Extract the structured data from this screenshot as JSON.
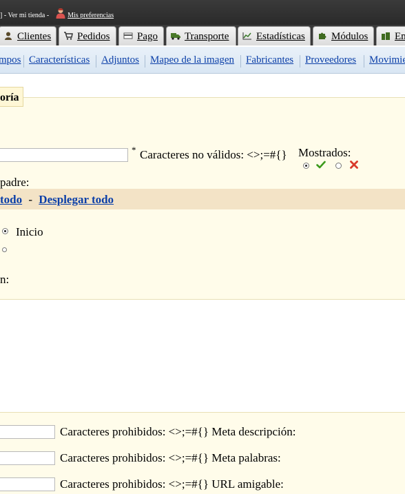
{
  "header": {
    "prefix_text": "] - Ver mi tienda -",
    "preferences_link": "Mis preferencias"
  },
  "tabs": [
    {
      "label": "Clientes",
      "icon": "person-icon"
    },
    {
      "label": "Pedidos",
      "icon": "cart-icon"
    },
    {
      "label": "Pago",
      "icon": "card-icon"
    },
    {
      "label": "Transporte",
      "icon": "truck-icon"
    },
    {
      "label": "Estadísticas",
      "icon": "chart-icon"
    },
    {
      "label": "Módulos",
      "icon": "puzzle-icon"
    },
    {
      "label": "Em",
      "icon": "building-icon"
    }
  ],
  "subnav": {
    "items": [
      "mpos",
      "Características",
      "Adjuntos",
      "Mapeo de la imagen",
      "Fabricantes",
      "Proveedores",
      "Movimie"
    ]
  },
  "form": {
    "legend": "oría",
    "name_value": "",
    "required_mark": "*",
    "invalid_chars": "Caracteres no válidos: <>;=#{}",
    "shown_label": "Mostrados:",
    "parent_label": "padre:",
    "tree_collapse": "todo",
    "tree_separator": "-",
    "tree_expand": "Desplegar todo",
    "root_label": "Inicio",
    "description_label": "n:"
  },
  "meta": {
    "rows": [
      {
        "text": "Caracteres prohibidos: <>;=#{} Meta descripción:",
        "value": ""
      },
      {
        "text": "Caracteres prohibidos: <>;=#{} Meta palabras:",
        "value": ""
      },
      {
        "text": "Caracteres prohibidos: <>;=#{} URL amigable:",
        "value": ""
      }
    ]
  },
  "colors": {
    "link": "#0b3fa8",
    "panel": "#fffcea",
    "tree_bar": "#f3e3c6",
    "check": "#3c9a1c",
    "cross": "#d93a2b"
  }
}
